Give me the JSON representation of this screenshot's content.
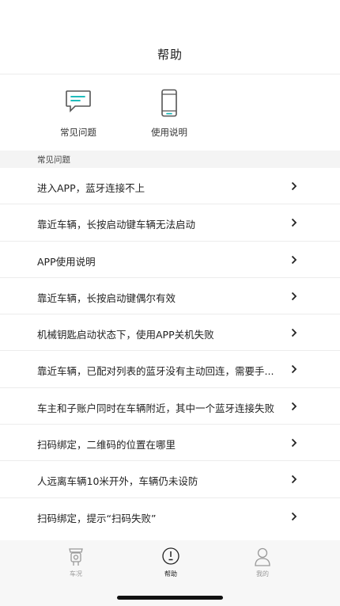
{
  "header": {
    "title": "帮助"
  },
  "shortcuts": [
    {
      "label": "常见问题",
      "icon": "chat-bubble-icon"
    },
    {
      "label": "使用说明",
      "icon": "phone-icon"
    }
  ],
  "section": {
    "title": "常见问题"
  },
  "faq": [
    "进入APP，蓝牙连接不上",
    "靠近车辆，长按启动键车辆无法启动",
    "APP使用说明",
    "靠近车辆，长按启动键偶尔有效",
    "机械钥匙启动状态下，使用APP关机失败",
    "靠近车辆，已配对列表的蓝牙没有主动回连，需要手...",
    "车主和子账户同时在车辆附近，其中一个蓝牙连接失败",
    "扫码绑定，二维码的位置在哪里",
    "人远离车辆10米开外，车辆仍未设防",
    "扫码绑定，提示“扫码失败”"
  ],
  "tabs": [
    {
      "label": "车况",
      "icon": "vehicle-icon",
      "active": false
    },
    {
      "label": "帮助",
      "icon": "lightbulb-icon",
      "active": true
    },
    {
      "label": "我的",
      "icon": "person-icon",
      "active": false
    }
  ],
  "colors": {
    "accent": "#00b3b3",
    "background": "#ffffff",
    "section_bg": "#f4f4f4",
    "tabbar_bg": "#f7f7f7"
  }
}
